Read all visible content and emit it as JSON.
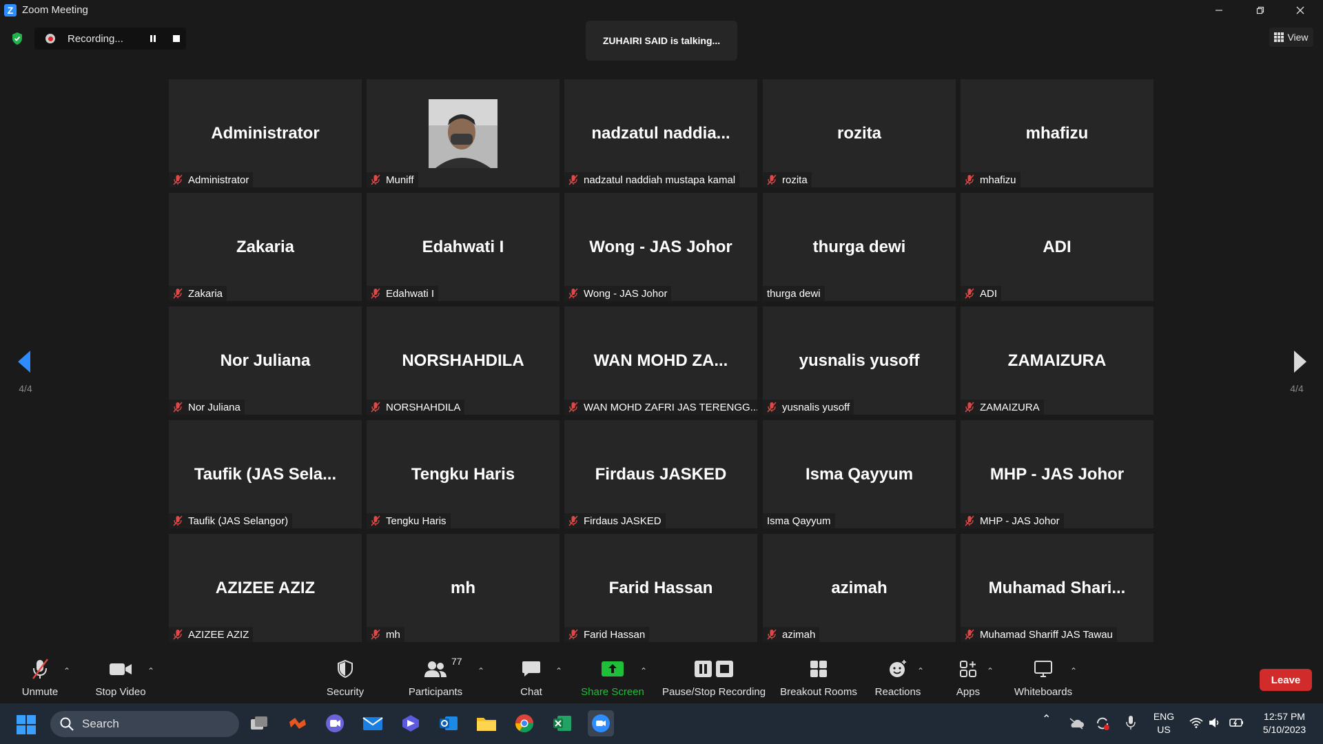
{
  "window": {
    "title": "Zoom Meeting",
    "logo": "Z"
  },
  "recording": {
    "label": "Recording..."
  },
  "talking_banner": "ZUHAIRI SAID is talking...",
  "view_button": "View",
  "pagination": {
    "left": "4/4",
    "right": "4/4"
  },
  "participants": [
    {
      "display": "Administrator",
      "tag": "Administrator",
      "muted": true
    },
    {
      "display": "",
      "tag": "Muniff",
      "muted": true,
      "photo": true
    },
    {
      "display": "nadzatul  naddia...",
      "tag": "nadzatul naddiah mustapa kamal",
      "muted": true
    },
    {
      "display": "rozita",
      "tag": "rozita",
      "muted": true
    },
    {
      "display": "mhafizu",
      "tag": "mhafizu",
      "muted": true
    },
    {
      "display": "Zakaria",
      "tag": "Zakaria",
      "muted": true
    },
    {
      "display": "Edahwati I",
      "tag": "Edahwati I",
      "muted": true
    },
    {
      "display": "Wong - JAS Johor",
      "tag": "Wong - JAS Johor",
      "muted": true
    },
    {
      "display": "thurga dewi",
      "tag": "thurga dewi",
      "muted": false
    },
    {
      "display": "ADI",
      "tag": "ADI",
      "muted": true
    },
    {
      "display": "Nor Juliana",
      "tag": "Nor Juliana",
      "muted": true
    },
    {
      "display": "NORSHAHDILA",
      "tag": "NORSHAHDILA",
      "muted": true
    },
    {
      "display": "WAN  MOHD  ZA...",
      "tag": "WAN MOHD ZAFRI JAS TERENGG...",
      "muted": true
    },
    {
      "display": "yusnalis yusoff",
      "tag": "yusnalis yusoff",
      "muted": true
    },
    {
      "display": "ZAMAIZURA",
      "tag": "ZAMAIZURA",
      "muted": true
    },
    {
      "display": "Taufik  (JAS  Sela...",
      "tag": "Taufik (JAS Selangor)",
      "muted": true
    },
    {
      "display": "Tengku Haris",
      "tag": "Tengku Haris",
      "muted": true
    },
    {
      "display": "Firdaus JASKED",
      "tag": "Firdaus JASKED",
      "muted": true
    },
    {
      "display": "Isma Qayyum",
      "tag": "Isma Qayyum",
      "muted": false
    },
    {
      "display": "MHP - JAS Johor",
      "tag": "MHP - JAS Johor",
      "muted": true
    },
    {
      "display": "AZIZEE AZIZ",
      "tag": "AZIZEE AZIZ",
      "muted": true
    },
    {
      "display": "mh",
      "tag": "mh",
      "muted": true
    },
    {
      "display": "Farid Hassan",
      "tag": "Farid Hassan",
      "muted": true
    },
    {
      "display": "azimah",
      "tag": "azimah",
      "muted": true
    },
    {
      "display": "Muhamad  Shari...",
      "tag": "Muhamad Shariff JAS Tawau",
      "muted": true
    }
  ],
  "toolbar": {
    "unmute": "Unmute",
    "stop_video": "Stop Video",
    "security": "Security",
    "participants": "Participants",
    "participants_count": "77",
    "chat": "Chat",
    "share_screen": "Share Screen",
    "pause_stop_recording": "Pause/Stop Recording",
    "breakout_rooms": "Breakout Rooms",
    "reactions": "Reactions",
    "apps": "Apps",
    "whiteboards": "Whiteboards",
    "leave": "Leave"
  },
  "taskbar": {
    "search": "Search",
    "lang_top": "ENG",
    "lang_bottom": "US",
    "time": "12:57 PM",
    "date": "5/10/2023"
  },
  "colors": {
    "accent": "#2d8cff",
    "share_green": "#1fbf3a",
    "leave_red": "#d22b2b",
    "mute_red": "#e04848"
  }
}
